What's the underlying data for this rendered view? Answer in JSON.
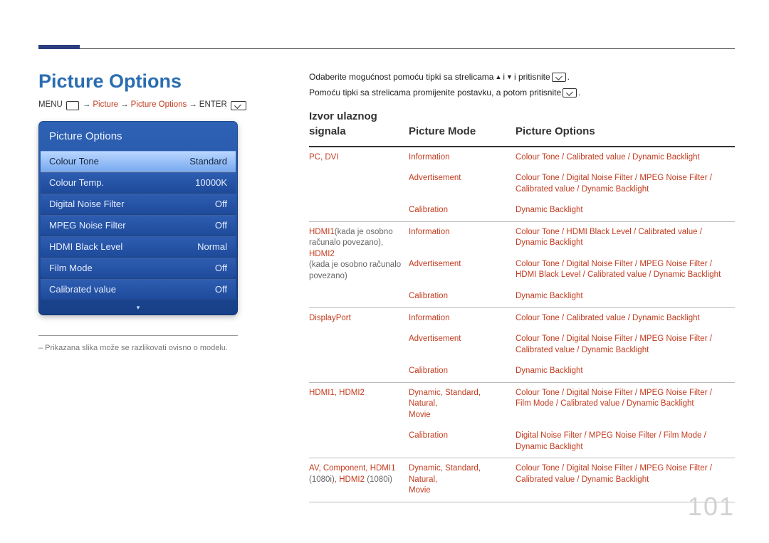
{
  "title": "Picture Options",
  "breadcrumb": {
    "menu": "MENU",
    "p1": "Picture",
    "p2": "Picture Options",
    "enter": "ENTER"
  },
  "osd": {
    "title": "Picture Options",
    "rows": [
      {
        "label": "Colour Tone",
        "value": "Standard",
        "selected": true
      },
      {
        "label": "Colour Temp.",
        "value": "10000K"
      },
      {
        "label": "Digital Noise Filter",
        "value": "Off"
      },
      {
        "label": "MPEG Noise Filter",
        "value": "Off"
      },
      {
        "label": "HDMI Black Level",
        "value": "Normal"
      },
      {
        "label": "Film Mode",
        "value": "Off"
      },
      {
        "label": "Calibrated value",
        "value": "Off"
      }
    ]
  },
  "footnote": "– Prikazana slika može se razlikovati ovisno o modelu.",
  "instructions": {
    "line1_a": "Odaberite mogućnost pomoću tipki sa strelicama ",
    "line1_b": " i ",
    "line1_c": " i pritisnite ",
    "line2_a": "Pomoću tipki sa strelicama promijenite postavku, a potom pritisnite "
  },
  "table": {
    "headers": [
      "Izvor ulaznog signala",
      "Picture Mode",
      "Picture Options"
    ],
    "groups": [
      {
        "source_html": "<span class='red'>PC</span><span class='sepc red'></span><span class='red'>DVI</span>",
        "rows": [
          {
            "mode": "<span class='red'>Information</span>",
            "opts": "<span class='red'>Colour Tone</span><span class='sep'></span><span class='red'>Calibrated value</span><span class='sep'></span><span class='red'>Dynamic Backlight</span>"
          },
          {
            "mode": "<span class='red'>Advertisement</span>",
            "opts": "<span class='red'>Colour Tone</span><span class='sep'></span><span class='red'>Digital Noise Filter</span><span class='sep'></span><span class='red'>MPEG Noise Filter</span><span class='sep'></span><br><span class='red'>Calibrated value</span><span class='sep'></span><span class='red'>Dynamic Backlight</span>"
          },
          {
            "mode": "<span class='red'>Calibration</span>",
            "opts": "<span class='red'>Dynamic Backlight</span>"
          }
        ]
      },
      {
        "source_html": "<span class='red'>HDMI1</span><span class='muted'>(kada je osobno računalo povezano), </span><span class='red'>HDMI2</span><br><span class='muted'>(kada je osobno računalo povezano)</span>",
        "rows": [
          {
            "mode": "<span class='red'>Information</span>",
            "opts": "<span class='red'>Colour Tone</span><span class='sep'></span><span class='red'>HDMI Black Level</span><span class='sep'></span><span class='red'>Calibrated value</span><span class='sep'></span><br><span class='red'>Dynamic Backlight</span>"
          },
          {
            "mode": "<span class='red'>Advertisement</span>",
            "opts": "<span class='red'>Colour Tone</span><span class='sep'></span><span class='red'>Digital Noise Filter</span><span class='sep'></span><span class='red'>MPEG Noise Filter</span><span class='sep'></span><br><span class='red'>HDMI Black Level</span><span class='sep'></span><span class='red'>Calibrated value</span><span class='sep'></span><span class='red'>Dynamic Backlight</span>"
          },
          {
            "mode": "<span class='red'>Calibration</span>",
            "opts": "<span class='red'>Dynamic Backlight</span>"
          }
        ]
      },
      {
        "source_html": "<span class='red'>DisplayPort</span>",
        "rows": [
          {
            "mode": "<span class='red'>Information</span>",
            "opts": "<span class='red'>Colour Tone</span><span class='sep'></span><span class='red'>Calibrated value</span><span class='sep'></span><span class='red'>Dynamic Backlight</span>"
          },
          {
            "mode": "<span class='red'>Advertisement</span>",
            "opts": "<span class='red'>Colour Tone</span><span class='sep'></span><span class='red'>Digital Noise Filter</span><span class='sep'></span><span class='red'>MPEG Noise Filter</span><span class='sep'></span><br><span class='red'>Calibrated value</span><span class='sep'></span><span class='red'>Dynamic Backlight</span>"
          },
          {
            "mode": "<span class='red'>Calibration</span>",
            "opts": "<span class='red'>Dynamic Backlight</span>"
          }
        ]
      },
      {
        "source_html": "<span class='red'>HDMI1</span><span class='sepc red'></span><span class='red'>HDMI2</span>",
        "rows": [
          {
            "mode": "<span class='red'>Dynamic</span><span class='sepc red'></span><span class='red'>Standard</span><span class='sepc red'></span><span class='red'>Natural</span><span class='sepc red'></span><br><span class='red'>Movie</span>",
            "opts": "<span class='red'>Colour Tone</span><span class='sep'></span><span class='red'>Digital Noise Filter</span><span class='sep'></span><span class='red'>MPEG Noise Filter</span><span class='sep'></span><br><span class='red'>Film Mode</span><span class='sep'></span><span class='red'>Calibrated value</span><span class='sep'></span><span class='red'>Dynamic Backlight</span>"
          },
          {
            "mode": "<span class='red'>Calibration</span>",
            "opts": "<span class='red'>Digital Noise Filter</span><span class='sep'></span><span class='red'>MPEG Noise Filter</span><span class='sep'></span><span class='red'>Film Mode</span><span class='sep'></span><br><span class='red'>Dynamic Backlight</span>"
          }
        ]
      },
      {
        "source_html": "<span class='red'>AV</span><span class='sepc red'></span><span class='red'>Component</span><span class='sepc red'></span><span class='red'>HDMI1</span> <span class='muted'>(1080i)</span><span class='sepc red'></span><span class='red'>HDMI2</span> <span class='muted'>(1080i)</span>",
        "rows": [
          {
            "mode": "<span class='red'>Dynamic</span><span class='sepc red'></span><span class='red'>Standard</span><span class='sepc red'></span><span class='red'>Natural</span><span class='sepc red'></span><br><span class='red'>Movie</span>",
            "opts": "<span class='red'>Colour Tone</span><span class='sep'></span><span class='red'>Digital Noise Filter</span><span class='sep'></span><span class='red'>MPEG Noise Filter</span><span class='sep'></span><br><span class='red'>Calibrated value</span><span class='sep'></span><span class='red'>Dynamic Backlight</span>"
          }
        ]
      }
    ]
  },
  "page_number": "101"
}
